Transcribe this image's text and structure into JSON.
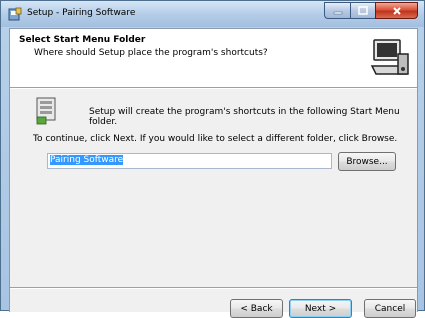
{
  "window": {
    "title": "Setup - Pairing Software",
    "close_glyph": "✕",
    "min_glyph": "▁",
    "max_glyph": "□"
  },
  "header": {
    "title": "Select Start Menu Folder",
    "subtitle": "Where should Setup place the program's shortcuts?",
    "graphic_icon": "computer-install-icon"
  },
  "body": {
    "info_text": "Setup will create the program's shortcuts in the following Start Menu folder.",
    "continue_text": "To continue, click Next. If you would like to select a different folder, click Browse.",
    "folder_value": "Pairing Software",
    "browse_label": "Browse..."
  },
  "footer": {
    "back_label": "< Back",
    "next_label": "Next >",
    "cancel_label": "Cancel"
  }
}
